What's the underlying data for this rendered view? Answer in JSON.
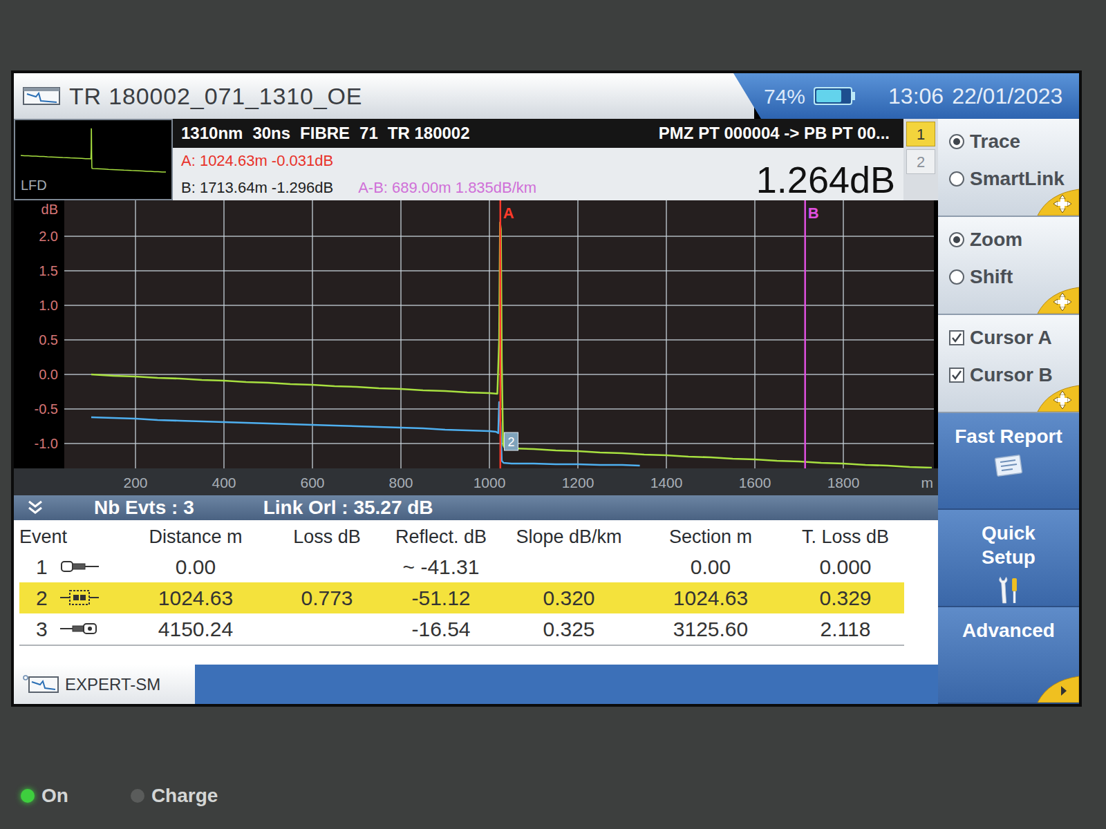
{
  "title_bar": {
    "title": "TR 180002_071_1310_OE",
    "battery": "74%",
    "battery_level": 0.74,
    "time": "13:06",
    "date": "22/01/2023"
  },
  "header": {
    "thumbnail_label": "LFD",
    "info": [
      "1310nm",
      "30ns",
      "FIBRE",
      "71",
      "TR 180002"
    ],
    "route": "PMZ PT 000004 -> PB PT 00...",
    "cursor_a": "A: 1024.63m -0.031dB",
    "cursor_b": "B: 1713.64m -1.296dB",
    "a_b": "A-B: 689.00m 1.835dB/km",
    "loss": "1.264dB",
    "trace_tabs": [
      {
        "label": "1",
        "selected": true
      },
      {
        "label": "2",
        "selected": false
      }
    ]
  },
  "chart": {
    "y_unit": "dB",
    "y_ticks": [
      "2.0",
      "1.5",
      "1.0",
      "0.5",
      "0.0",
      "-0.5",
      "-1.0"
    ],
    "x_ticks": [
      "200",
      "400",
      "600",
      "800",
      "1000",
      "1200",
      "1400",
      "1600",
      "1800"
    ],
    "x_unit": "m",
    "series": [
      {
        "name": "trace-2",
        "color": "#4fb0f0",
        "x": [
          100,
          150,
          200,
          250,
          300,
          350,
          400,
          450,
          500,
          550,
          600,
          650,
          700,
          750,
          800,
          850,
          900,
          950,
          1000,
          1015,
          1020,
          1022,
          1025,
          1028,
          1032,
          1050,
          1100,
          1150,
          1200,
          1250,
          1300,
          1340
        ],
        "y": [
          -0.62,
          -0.63,
          -0.64,
          -0.66,
          -0.67,
          -0.68,
          -0.69,
          -0.7,
          -0.71,
          -0.72,
          -0.73,
          -0.74,
          -0.75,
          -0.76,
          -0.77,
          -0.78,
          -0.8,
          -0.81,
          -0.82,
          -0.83,
          -0.85,
          -0.4,
          -0.7,
          -1.25,
          -1.28,
          -1.29,
          -1.29,
          -1.3,
          -1.3,
          -1.31,
          -1.31,
          -1.32
        ]
      },
      {
        "name": "trace-1",
        "color": "#a8e040",
        "x": [
          100,
          150,
          200,
          250,
          300,
          350,
          400,
          450,
          500,
          550,
          600,
          650,
          700,
          750,
          800,
          850,
          900,
          950,
          1000,
          1018,
          1022,
          1024,
          1026,
          1028,
          1031,
          1034,
          1050,
          1100,
          1150,
          1200,
          1250,
          1300,
          1350,
          1400,
          1450,
          1500,
          1550,
          1600,
          1650,
          1700,
          1750,
          1800,
          1850,
          1900,
          1950,
          2000
        ],
        "y": [
          0.0,
          -0.02,
          -0.03,
          -0.05,
          -0.06,
          -0.08,
          -0.09,
          -0.11,
          -0.12,
          -0.14,
          -0.15,
          -0.17,
          -0.18,
          -0.2,
          -0.21,
          -0.23,
          -0.24,
          -0.26,
          -0.27,
          -0.28,
          0.5,
          2.2,
          2.1,
          0.2,
          -1.02,
          -1.06,
          -1.07,
          -1.08,
          -1.1,
          -1.11,
          -1.13,
          -1.14,
          -1.16,
          -1.17,
          -1.19,
          -1.2,
          -1.22,
          -1.23,
          -1.25,
          -1.26,
          -1.28,
          -1.29,
          -1.31,
          -1.32,
          -1.34,
          -1.35
        ]
      }
    ],
    "cursors": [
      {
        "label": "A",
        "distance": 1024.63,
        "color": "#ff3a2a"
      },
      {
        "label": "B",
        "distance": 1713.64,
        "color": "#e050e0"
      }
    ],
    "event_markers": [
      {
        "label": "2",
        "distance": 1032,
        "value": -0.97
      }
    ]
  },
  "summary": {
    "events": "Nb Evts : 3",
    "orl": "Link Orl : 35.27 dB"
  },
  "table": {
    "columns": [
      "Event",
      "Distance m",
      "Loss dB",
      "Reflect. dB",
      "Slope dB/km",
      "Section m",
      "T. Loss dB"
    ],
    "rows": [
      {
        "kind": "launch",
        "selected": false,
        "cells": [
          "1",
          "0.00",
          "",
          "~ -41.31",
          "",
          "0.00",
          "0.000"
        ]
      },
      {
        "kind": "connector",
        "selected": true,
        "cells": [
          "2",
          "1024.63",
          "0.773",
          "-51.12",
          "0.320",
          "1024.63",
          "0.329"
        ]
      },
      {
        "kind": "end",
        "selected": false,
        "cells": [
          "3",
          "4150.24",
          "",
          "-16.54",
          "0.325",
          "3125.60",
          "2.118"
        ]
      }
    ]
  },
  "bottom_tab": {
    "label": "EXPERT-SM"
  },
  "sidebar": {
    "groups": [
      {
        "kind": "radio",
        "items": [
          {
            "label": "Trace",
            "selected": true
          },
          {
            "label": "SmartLink",
            "selected": false
          }
        ]
      },
      {
        "kind": "radio",
        "items": [
          {
            "label": "Zoom",
            "selected": true
          },
          {
            "label": "Shift",
            "selected": false
          }
        ]
      },
      {
        "kind": "checkbox",
        "items": [
          {
            "label": "Cursor A",
            "checked": true
          },
          {
            "label": "Cursor B",
            "checked": true
          }
        ]
      }
    ],
    "buttons": [
      {
        "label": "Fast Report",
        "kind": "report"
      },
      {
        "label": "Quick Setup",
        "kind": "setup"
      },
      {
        "label": "Advanced",
        "kind": "more"
      }
    ]
  },
  "leds": [
    {
      "label": "On",
      "on": true,
      "color": "#3ecf3e"
    },
    {
      "label": "Charge",
      "on": false,
      "color": "#5a5c5b"
    }
  ]
}
